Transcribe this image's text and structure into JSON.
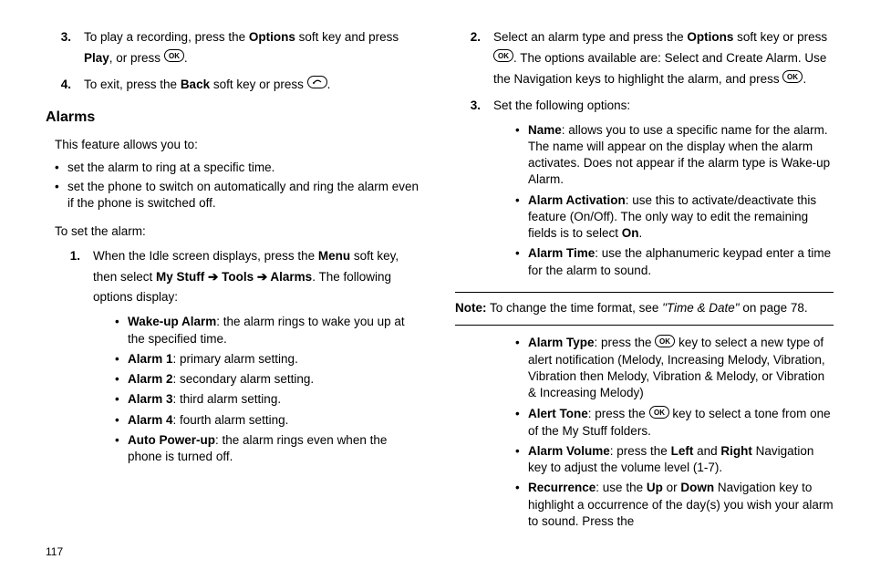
{
  "left": {
    "step3_num": "3.",
    "step3_a": "To play a recording, press the ",
    "step3_b": " soft key and press ",
    "step3_c": ", or press ",
    "step4_num": "4.",
    "step4_a": "To exit, press the ",
    "step4_b": " soft key or press ",
    "heading": "Alarms",
    "intro": "This feature allows you to:",
    "b1": "set the alarm to ring at a specific time.",
    "b2": "set the phone to switch on automatically and ring the alarm even if the phone is switched off.",
    "toset": "To set the alarm:",
    "s1_num": "1.",
    "s1_a": "When the Idle screen displays, press the ",
    "s1_b": " soft key, then select ",
    "s1_c": ". The following options display:",
    "opt1_l": "Wake-up Alarm",
    "opt1_t": ": the alarm rings to wake you up at the specified time.",
    "opt2_l": "Alarm 1",
    "opt2_t": ": primary alarm setting.",
    "opt3_l": "Alarm 2",
    "opt3_t": ": secondary alarm setting.",
    "opt4_l": "Alarm 3",
    "opt4_t": ": third alarm setting.",
    "opt5_l": "Alarm 4",
    "opt5_t": ": fourth alarm setting.",
    "opt6_l": "Auto Power-up",
    "opt6_t": ": the alarm rings even when the phone is turned off.",
    "bold": {
      "options": "Options",
      "play": "Play",
      "back": "Back",
      "menu": "Menu",
      "path": "My Stuff ➔ Tools ➔ Alarms"
    }
  },
  "right": {
    "s2_num": "2.",
    "s2_a": "Select an alarm type and press the ",
    "s2_b": " soft key or press ",
    "s2_c": ". The options available are: Select and Create Alarm. Use the Navigation keys to highlight the alarm, and press ",
    "s3_num": "3.",
    "s3": "Set the following options:",
    "o1_l": "Name",
    "o1_t": ": allows you to use a specific name for the alarm. The name will appear on the display when the alarm activates. Does not appear if the alarm type is Wake-up Alarm.",
    "o2_l": "Alarm Activation",
    "o2_t1": ": use this to activate/deactivate this feature (On/Off). The only way to edit the remaining fields is to select ",
    "o2_t2": ".",
    "o3_l": "Alarm Time",
    "o3_t": ": use the alphanumeric keypad enter a time for the alarm to sound.",
    "note_a": " To change the time format, see ",
    "note_b": "\"Time & Date\"",
    "note_c": " on page 78.",
    "o4_l": "Alarm Type",
    "o4_t1": ": press the ",
    "o4_t2": " key to select a new type of alert notification (Melody, Increasing Melody, Vibration, Vibration then Melody, Vibration & Melody, or Vibration & Increasing Melody)",
    "o5_l": "Alert Tone",
    "o5_t1": ": press the ",
    "o5_t2": " key to select a tone from one of the My Stuff folders.",
    "o6_l": "Alarm Volume",
    "o6_t1": ": press the ",
    "o6_t2": " and ",
    "o6_t3": " Navigation key to adjust the volume level (1-7).",
    "o7_l": "Recurrence",
    "o7_t1": ": use the ",
    "o7_t2": " or ",
    "o7_t3": " Navigation key to highlight a occurrence of the day(s) you wish your alarm to sound. Press the",
    "bold": {
      "options": "Options",
      "on": "On",
      "note": "Note:",
      "left": "Left",
      "right": "Right",
      "up": "Up",
      "down": "Down"
    }
  },
  "page_number": "117"
}
